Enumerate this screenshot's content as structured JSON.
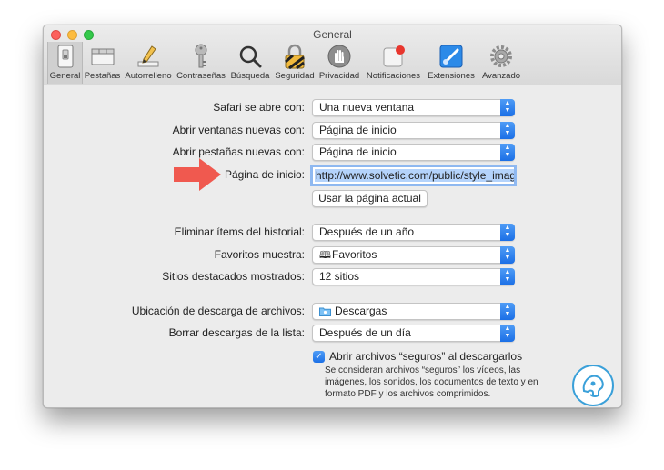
{
  "window": {
    "title": "General"
  },
  "toolbar": {
    "items": [
      {
        "label": "General",
        "icon": "switch-icon"
      },
      {
        "label": "Pestañas",
        "icon": "tabs-icon"
      },
      {
        "label": "Autorrelleno",
        "icon": "pencil-icon"
      },
      {
        "label": "Contraseñas",
        "icon": "key-icon"
      },
      {
        "label": "Búsqueda",
        "icon": "magnifier-icon"
      },
      {
        "label": "Seguridad",
        "icon": "padlock-icon"
      },
      {
        "label": "Privacidad",
        "icon": "hand-icon"
      },
      {
        "label": "Notificaciones",
        "icon": "notification-icon"
      },
      {
        "label": "Extensiones",
        "icon": "puzzle-icon"
      },
      {
        "label": "Avanzado",
        "icon": "gear-icon"
      }
    ]
  },
  "form": {
    "safari_opens_label": "Safari se abre con:",
    "safari_opens_value": "Una nueva ventana",
    "new_windows_label": "Abrir ventanas nuevas con:",
    "new_windows_value": "Página de inicio",
    "new_tabs_label": "Abrir pestañas nuevas con:",
    "new_tabs_value": "Página de inicio",
    "homepage_label": "Página de inicio:",
    "homepage_value": "http://www.solvetic.com/public/style_image",
    "use_current_label": "Usar la página actual",
    "remove_history_label": "Eliminar ítems del historial:",
    "remove_history_value": "Después de un año",
    "favorites_label": "Favoritos muestra:",
    "favorites_value": "Favoritos",
    "top_sites_label": "Sitios destacados mostrados:",
    "top_sites_value": "12 sitios",
    "download_location_label": "Ubicación de descarga de archivos:",
    "download_location_value": "Descargas",
    "clear_downloads_label": "Borrar descargas de la lista:",
    "clear_downloads_value": "Después de un día",
    "open_safe_label": "Abrir archivos “seguros” al descargarlos",
    "open_safe_checked": true,
    "open_safe_note": "Se consideran archivos “seguros” los vídeos, las imágenes, los sonidos, los documentos de texto y en formato PDF y los archivos comprimidos."
  },
  "colors": {
    "accent": "#1b6fe6",
    "arrow": "#f0594f",
    "watermark": "#3aa0d9"
  }
}
